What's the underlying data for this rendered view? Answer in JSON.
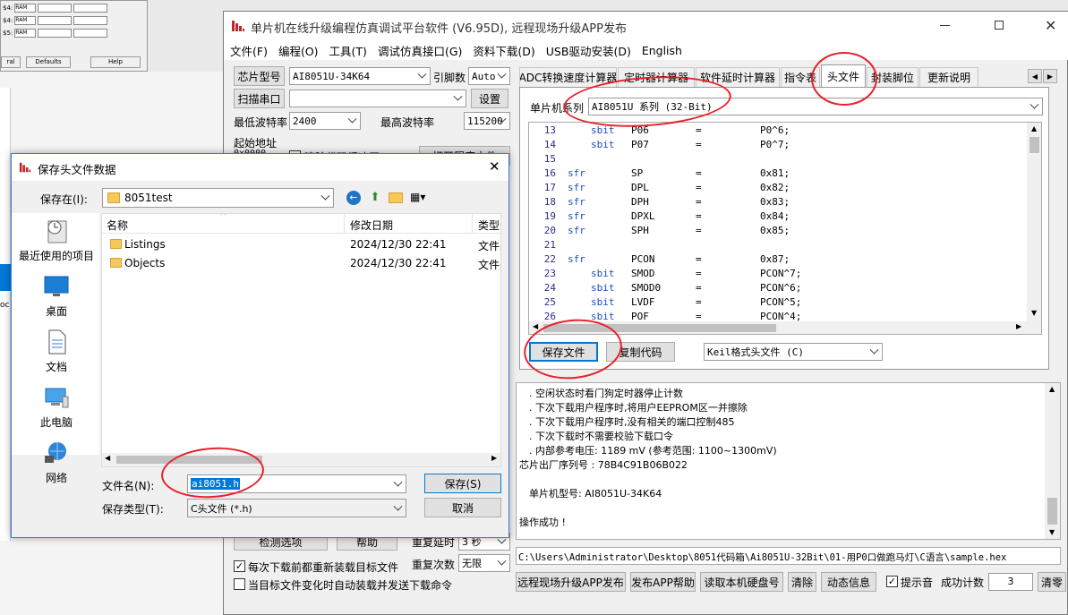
{
  "bg_window": {
    "rows": [
      {
        "label": "$4:",
        "value": "RAM"
      },
      {
        "label": "$4:",
        "value": "RAM"
      },
      {
        "label": "$5:",
        "value": "RAM"
      }
    ],
    "buttons": [
      "ral",
      "Defaults",
      "Help"
    ],
    "side_label": "oc"
  },
  "main": {
    "title": "单片机在线升级编程仿真调试平台软件 (V6.95D), 远程现场升级APP发布",
    "menu": [
      "文件(F)",
      "编程(O)",
      "工具(T)",
      "调试仿真接口(G)",
      "资料下载(D)",
      "USB驱动安装(D)",
      "English"
    ],
    "chip_btn": "芯片型号",
    "chip_value": "AI8051U-34K64",
    "pin_label": "引脚数",
    "pin_value": "Auto",
    "scan_btn": "扫描串口",
    "scan_value": "",
    "settings_btn": "设置",
    "min_baud_label": "最低波特率",
    "min_baud": "2400",
    "max_baud_label": "最高波特率",
    "max_baud": "115200",
    "start_addr_label": "起始地址",
    "start_addr_value": "0x0000",
    "clear_code_label": "清除代码缓冲区",
    "open_prog_btn": "打开程序文件",
    "tabs": [
      "ADC转换速度计算器",
      "定时器计算器",
      "软件延时计算器",
      "指令表",
      "头文件",
      "封装脚位",
      "更新说明"
    ],
    "active_tab": "头文件",
    "series_label": "单片机系列",
    "series_value": "AI8051U 系列 (32-Bit)",
    "code_lines": [
      {
        "n": "13",
        "a": "",
        "b": "sbit",
        "c": "P06",
        "d": "=",
        "e": "P0^6;"
      },
      {
        "n": "14",
        "a": "",
        "b": "sbit",
        "c": "P07",
        "d": "=",
        "e": "P0^7;"
      },
      {
        "n": "15",
        "a": "",
        "b": "",
        "c": "",
        "d": "",
        "e": ""
      },
      {
        "n": "16",
        "a": "sfr",
        "b": "",
        "c": "SP",
        "d": "=",
        "e": "0x81;"
      },
      {
        "n": "17",
        "a": "sfr",
        "b": "",
        "c": "DPL",
        "d": "=",
        "e": "0x82;"
      },
      {
        "n": "18",
        "a": "sfr",
        "b": "",
        "c": "DPH",
        "d": "=",
        "e": "0x83;"
      },
      {
        "n": "19",
        "a": "sfr",
        "b": "",
        "c": "DPXL",
        "d": "=",
        "e": "0x84;"
      },
      {
        "n": "20",
        "a": "sfr",
        "b": "",
        "c": "SPH",
        "d": "=",
        "e": "0x85;"
      },
      {
        "n": "21",
        "a": "",
        "b": "",
        "c": "",
        "d": "",
        "e": ""
      },
      {
        "n": "22",
        "a": "sfr",
        "b": "",
        "c": "PCON",
        "d": "=",
        "e": "0x87;"
      },
      {
        "n": "23",
        "a": "",
        "b": "sbit",
        "c": "SMOD",
        "d": "=",
        "e": "PCON^7;"
      },
      {
        "n": "24",
        "a": "",
        "b": "sbit",
        "c": "SMOD0",
        "d": "=",
        "e": "PCON^6;"
      },
      {
        "n": "25",
        "a": "",
        "b": "sbit",
        "c": "LVDF",
        "d": "=",
        "e": "PCON^5;"
      },
      {
        "n": "26",
        "a": "",
        "b": "sbit",
        "c": "POF",
        "d": "=",
        "e": "PCON^4;"
      }
    ],
    "save_file_btn": "保存文件",
    "copy_code_btn": "复制代码",
    "header_format": "Keil格式头文件 (C)",
    "log_lines": [
      "　. 空闲状态时看门狗定时器停止计数",
      "　. 下次下载用户程序时,将用户EEPROM区一并擦除",
      "　. 下次下载用户程序时,没有相关的端口控制485",
      "　. 下次下载时不需要校验下载口令",
      "　. 内部参考电压: 1189 mV (参考范围: 1100~1300mV)",
      "芯片出厂序列号 : 78B4C91B06B022",
      "",
      "　单片机型号: AI8051U-34K64",
      "",
      "操作成功 !"
    ],
    "path": "C:\\Users\\Administrator\\Desktop\\8051代码箱\\Ai8051U-32Bit\\01-用P0口做跑马灯\\C语言\\sample.hex",
    "detect_btn": "检测选项",
    "help_btn": "帮助",
    "retry_delay_label": "重复延时",
    "retry_delay_value": "3 秒",
    "retry_count_label": "重复次数",
    "retry_count_value": "无限",
    "reload_label": "每次下载前都重新装载目标文件",
    "auto_label": "当目标文件变化时自动装载并发送下载命令",
    "bottom_buttons": [
      "远程现场升级APP发布",
      "发布APP帮助",
      "读取本机硬盘号",
      "清除",
      "动态信息"
    ],
    "beep_label": "提示音",
    "success_label": "成功计数",
    "success_count": "3",
    "reset_btn": "清零"
  },
  "dialog": {
    "title": "保存头文件数据",
    "save_in_label": "保存在(I):",
    "folder": "8051test",
    "places": [
      "最近使用的项目",
      "桌面",
      "文档",
      "此电脑",
      "网络"
    ],
    "col_name": "名称",
    "col_date": "修改日期",
    "col_type": "类型",
    "files": [
      {
        "name": "Listings",
        "date": "2024/12/30 22:41",
        "type": "文件夹"
      },
      {
        "name": "Objects",
        "date": "2024/12/30 22:41",
        "type": "文件夹"
      }
    ],
    "filename_label": "文件名(N):",
    "filename_value": "ai8051.h",
    "filetype_label": "保存类型(T):",
    "filetype_value": "C头文件 (*.h)",
    "save_btn": "保存(S)",
    "cancel_btn": "取消"
  },
  "colors": {
    "accent": "#0078d7",
    "annotation": "#e8202a",
    "keyword": "#1a4fc0",
    "linenum": "#2b2b91"
  }
}
